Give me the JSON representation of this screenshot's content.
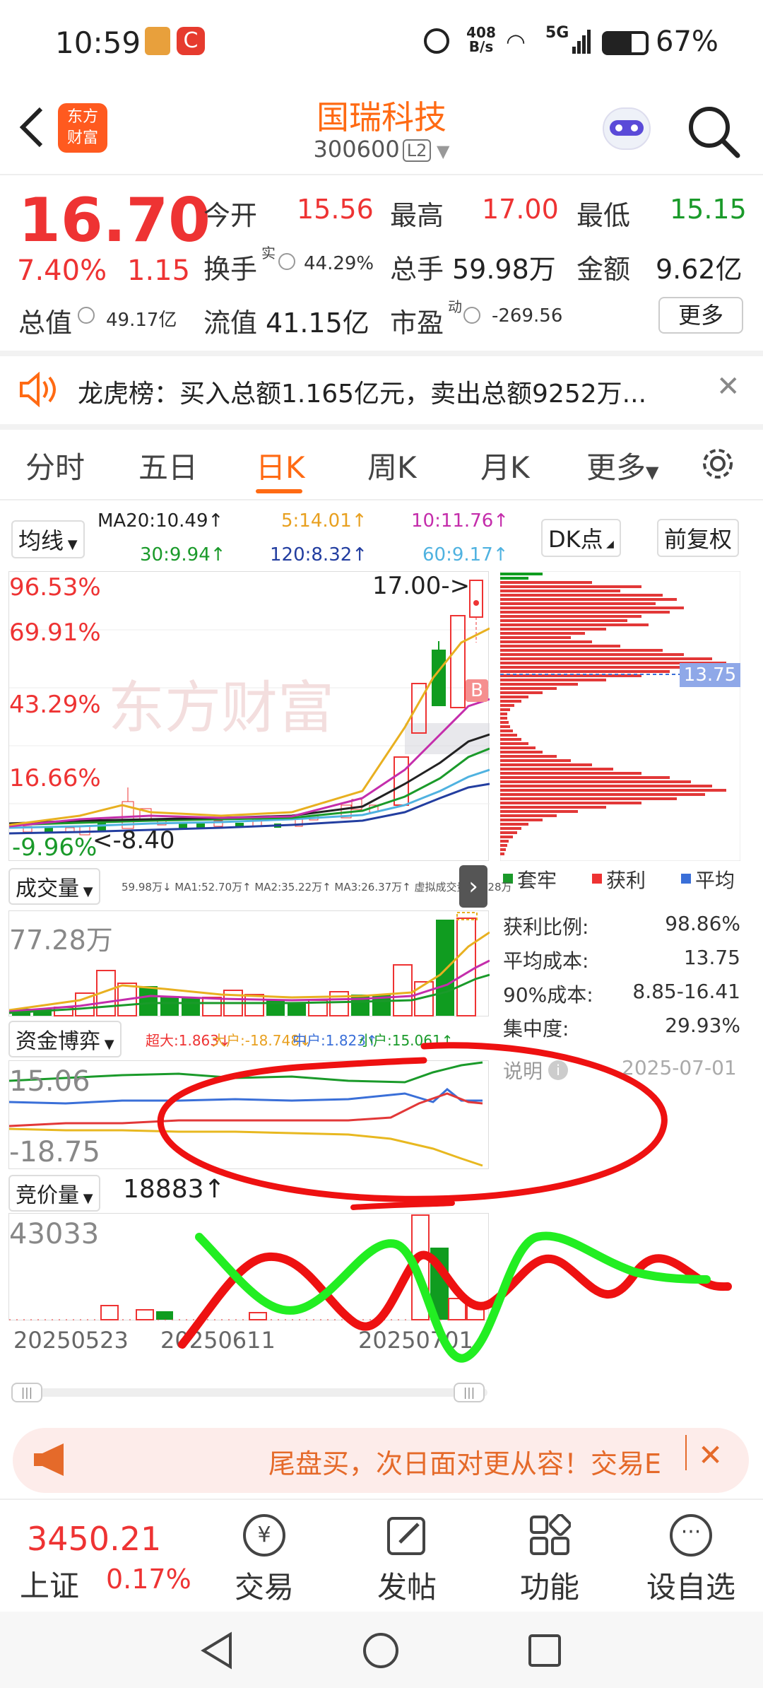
{
  "status_bar": {
    "time": "10:59",
    "speed": "408 B/s",
    "network": "5G",
    "battery": "67%"
  },
  "header": {
    "title": "国瑞科技",
    "code": "300600",
    "level": "L2",
    "logo_text": "东方财富"
  },
  "quote": {
    "price": "16.70",
    "change_pct": "7.40%",
    "change": "1.15",
    "open_label": "今开",
    "open": "15.56",
    "high_label": "最高",
    "high": "17.00",
    "low_label": "最低",
    "low": "15.15",
    "turnover_label": "换手",
    "turnover_sup": "实",
    "turnover": "44.29%",
    "volume_label": "总手",
    "volume": "59.98万",
    "amount_label": "金额",
    "amount": "9.62亿",
    "mcap_label": "总值",
    "mcap": "49.17亿",
    "float_label": "流值",
    "float": "41.15亿",
    "pe_label": "市盈",
    "pe_sup": "动",
    "pe": "-269.56",
    "more": "更多"
  },
  "notice": {
    "text": "龙虎榜：买入总额1.165亿元，卖出总额9252万..."
  },
  "tabs": [
    "分时",
    "五日",
    "日K",
    "周K",
    "月K",
    "更多",
    "⚙"
  ],
  "ma_panel": {
    "selector": "均线",
    "ma20": "MA20:10.49↑",
    "ma5": "5:14.01↑",
    "ma10": "10:11.76↑",
    "ma30": "30:9.94↑",
    "ma120": "120:8.32↑",
    "ma60": "60:9.17↑",
    "dk": "DK点",
    "adjust": "前复权"
  },
  "kchart": {
    "y_labels": [
      "96.53%",
      "69.91%",
      "43.29%",
      "16.66%",
      "-9.96%"
    ],
    "high_marker": "17.00->",
    "low_marker": "<-8.40",
    "b_marker": "B",
    "watermark": "东方财富",
    "cost_marker": "13.75",
    "colors": {
      "up": "#e33333",
      "down": "#109c20"
    }
  },
  "chip": {
    "legend": [
      "套牢",
      "获利",
      "平均"
    ],
    "stats": [
      {
        "label": "获利比例:",
        "value": "98.86%"
      },
      {
        "label": "平均成本:",
        "value": "13.75"
      },
      {
        "label": "90%成本:",
        "value": "8.85-16.41"
      },
      {
        "label": "集中度:",
        "value": "29.93%"
      }
    ],
    "note": "说明",
    "date": "2025-07-01"
  },
  "volume_panel": {
    "selector": "成交量",
    "header": "59.98万↓ MA1:52.70万↑ MA2:35.22万↑ MA3:26.37万↑ 虚拟成交量:77.28万",
    "max_label": "77.28万"
  },
  "fund_panel": {
    "selector": "资金博弈",
    "super": "超大:1.863↓",
    "big": "大户:-18.748↓",
    "mid": "中户:1.823↑",
    "small": "小户:15.061↑",
    "top_label": "15.06",
    "bottom_label": "-18.75"
  },
  "auction_panel": {
    "selector": "竞价量",
    "value": "18883↑",
    "max_label": "43033",
    "dates": [
      "20250523",
      "20250611",
      "20250701"
    ]
  },
  "banner": {
    "text": "尾盘买，次日面对更从容！交易E"
  },
  "bottom_nav": {
    "index_value": "3450.21",
    "index_name": "上证",
    "index_pct": "0.17%",
    "items": [
      "交易",
      "发帖",
      "功能",
      "设自选"
    ]
  }
}
